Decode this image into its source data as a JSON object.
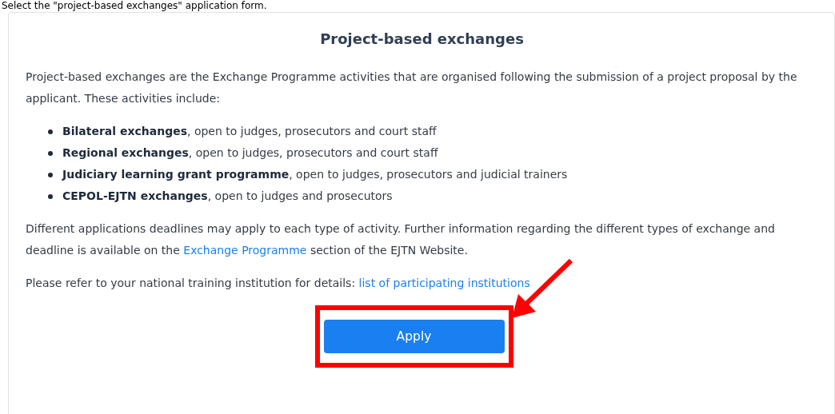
{
  "caption": "Select the \"project-based exchanges\" application form.",
  "card": {
    "title": "Project-based exchanges",
    "intro": "Project-based exchanges are the Exchange Programme activities that are organised following the submission of a project proposal by the applicant. These activities include:",
    "items": [
      {
        "name": "Bilateral exchanges",
        "rest": ", open to judges, prosecutors and court staff"
      },
      {
        "name": "Regional exchanges",
        "rest": ", open to judges, prosecutors and court staff"
      },
      {
        "name": "Judiciary learning grant programme",
        "rest": ", open to judges, prosecutors and judicial trainers"
      },
      {
        "name": "CEPOL-EJTN exchanges",
        "rest": ", open to judges and prosecutors"
      }
    ],
    "deadlines": {
      "before": "Different applications deadlines may apply to each type of activity. Further information regarding the different types of exchange and deadline is available on the",
      "link": "Exchange Programme",
      "after": "section of the EJTN Website."
    },
    "refer": {
      "text": "Please refer to your national training institution for details:",
      "link": "list of participating institutions"
    },
    "button": "Apply"
  }
}
